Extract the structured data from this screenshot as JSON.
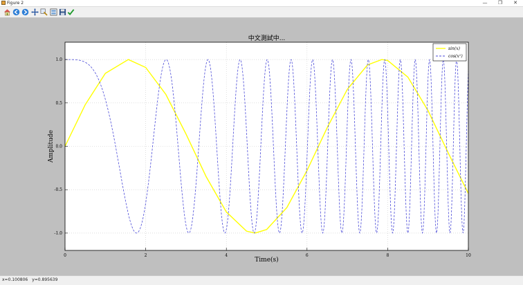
{
  "window": {
    "title": "Figure 2",
    "controls": {
      "minimize": "—",
      "restore": "❐",
      "close": "✕"
    }
  },
  "toolbar": {
    "buttons": [
      {
        "name": "home-button",
        "icon": "home-icon"
      },
      {
        "name": "back-button",
        "icon": "back-arrow-icon"
      },
      {
        "name": "forward-button",
        "icon": "forward-arrow-icon"
      },
      {
        "name": "pan-button",
        "icon": "pan-icon"
      },
      {
        "name": "zoom-button",
        "icon": "zoom-icon"
      },
      {
        "name": "subplots-button",
        "icon": "subplots-icon"
      },
      {
        "name": "save-button",
        "icon": "save-icon"
      },
      {
        "name": "edit-button",
        "icon": "checkmark-icon"
      }
    ]
  },
  "status": {
    "x_readout": "x=0.100806",
    "y_readout": "y=0.895639"
  },
  "chart_data": {
    "type": "line",
    "title": "中文測試中...",
    "xlabel": "Time(s)",
    "ylabel": "Amplitude",
    "xlim": [
      0,
      10
    ],
    "ylim": [
      -1.2,
      1.2
    ],
    "xticks": [
      0,
      2,
      4,
      6,
      8,
      10
    ],
    "yticks": [
      -1.0,
      -0.5,
      0.0,
      0.5,
      1.0
    ],
    "ytick_labels": [
      "-1.0",
      "-0.5",
      "0.0",
      "0.5",
      "1.0"
    ],
    "grid": true,
    "legend_placement": "top-right",
    "series": [
      {
        "name": "sin(x)",
        "legend_base": "sin(x)",
        "legend_sup": "",
        "color": "#ffff00",
        "style": "solid",
        "x": [
          0,
          0.5,
          1,
          1.5708,
          2,
          2.5,
          3,
          3.5,
          4,
          4.5,
          4.7124,
          5,
          5.5,
          6,
          6.5,
          7,
          7.5,
          7.854,
          8,
          8.5,
          9,
          9.5,
          10
        ],
        "y": [
          0,
          0.479,
          0.841,
          1.0,
          0.909,
          0.598,
          0.141,
          -0.351,
          -0.757,
          -0.978,
          -1.0,
          -0.959,
          -0.706,
          -0.279,
          0.215,
          0.657,
          0.938,
          1.0,
          0.989,
          0.798,
          0.412,
          -0.075,
          -0.544
        ]
      },
      {
        "name": "cos(x^2)",
        "legend_base": "cos(x",
        "legend_sup": "2",
        "legend_close": ")",
        "color": "#4a4ad8",
        "style": "dashed",
        "x_start": 0,
        "x_step": 0.01,
        "y": []
      }
    ]
  }
}
